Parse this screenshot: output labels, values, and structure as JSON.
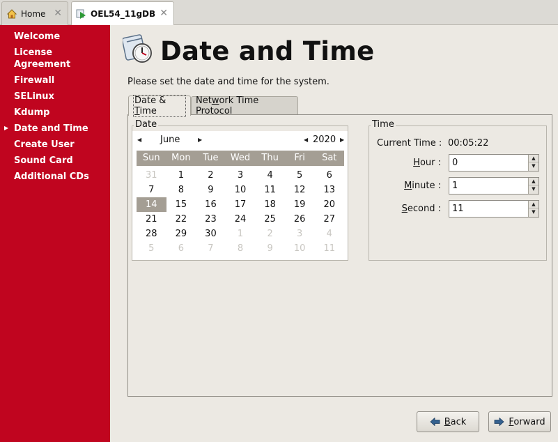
{
  "window_tabs": [
    {
      "label": "Home",
      "icon": "home-icon",
      "close": "✕"
    },
    {
      "label": "OEL54_11gDB",
      "icon": "vm-play-icon",
      "close": "✕"
    }
  ],
  "sidebar": {
    "items": [
      {
        "label": "Welcome"
      },
      {
        "label": "License Agreement"
      },
      {
        "label": "Firewall"
      },
      {
        "label": "SELinux"
      },
      {
        "label": "Kdump"
      },
      {
        "label": "Date and Time",
        "current": true
      },
      {
        "label": "Create User"
      },
      {
        "label": "Sound Card"
      },
      {
        "label": "Additional CDs"
      }
    ],
    "background": "#c0051f"
  },
  "page": {
    "title": "Date and Time",
    "instruction": "Please set the date and time for the system."
  },
  "tabs": {
    "date_time": {
      "label_pre": "Date & ",
      "label_ul": "T",
      "label_post": "ime"
    },
    "ntp": {
      "label_pre": "Net",
      "label_ul": "w",
      "label_post": "ork Time Protocol"
    }
  },
  "date_frame": {
    "label": "Date"
  },
  "calendar": {
    "month": "June",
    "year": "2020",
    "weekdays": [
      "Sun",
      "Mon",
      "Tue",
      "Wed",
      "Thu",
      "Fri",
      "Sat"
    ],
    "weeks": [
      [
        "31",
        "1",
        "2",
        "3",
        "4",
        "5",
        "6"
      ],
      [
        "7",
        "8",
        "9",
        "10",
        "11",
        "12",
        "13"
      ],
      [
        "14",
        "15",
        "16",
        "17",
        "18",
        "19",
        "20"
      ],
      [
        "21",
        "22",
        "23",
        "24",
        "25",
        "26",
        "27"
      ],
      [
        "28",
        "29",
        "30",
        "1",
        "2",
        "3",
        "4"
      ],
      [
        "5",
        "6",
        "7",
        "8",
        "9",
        "10",
        "11"
      ]
    ],
    "selected_day": "14",
    "header_color": "#a49e94"
  },
  "time_frame": {
    "label": "Time",
    "current_time_label": "Current Time :",
    "current_time": "00:05:22",
    "hour": {
      "label_ul": "H",
      "label_rest": "our :",
      "value": "0"
    },
    "minute": {
      "label_ul": "M",
      "label_rest": "inute :",
      "value": "1"
    },
    "second": {
      "label_ul": "S",
      "label_rest": "econd :",
      "value": "11"
    }
  },
  "buttons": {
    "back": {
      "label_ul": "B",
      "label_rest": "ack"
    },
    "forward": {
      "label_ul": "F",
      "label_rest": "orward"
    }
  }
}
